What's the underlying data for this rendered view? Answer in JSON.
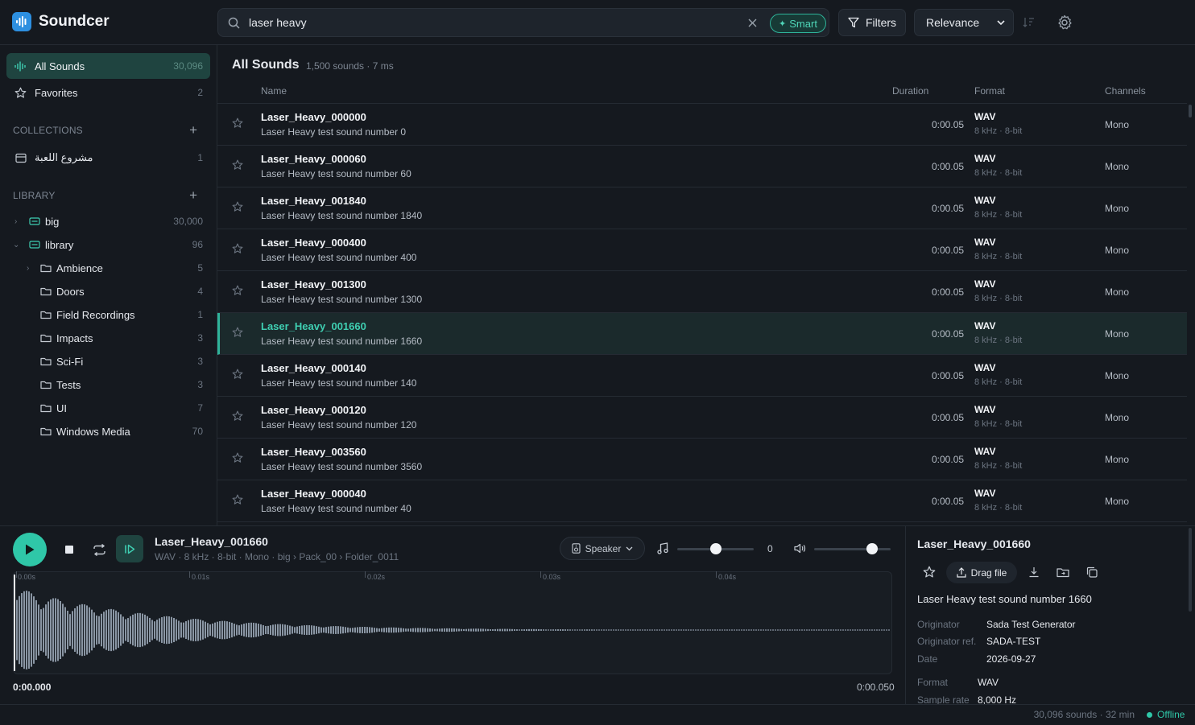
{
  "app": {
    "title": "Soundcer"
  },
  "search": {
    "value": "laser heavy",
    "smart_label": "Smart"
  },
  "toolbar": {
    "filters_label": "Filters",
    "sort_value": "Relevance"
  },
  "sidebar": {
    "all_sounds": {
      "label": "All Sounds",
      "count": "30,096"
    },
    "favorites": {
      "label": "Favorites",
      "count": "2"
    },
    "collections_header": "COLLECTIONS",
    "collections": [
      {
        "label": "مشروع اللعبة",
        "count": "1"
      }
    ],
    "library_header": "LIBRARY",
    "library": [
      {
        "label": "big",
        "count": "30,000"
      },
      {
        "label": "library",
        "count": "96"
      },
      {
        "label": "Ambience",
        "count": "5"
      },
      {
        "label": "Doors",
        "count": "4"
      },
      {
        "label": "Field Recordings",
        "count": "1"
      },
      {
        "label": "Impacts",
        "count": "3"
      },
      {
        "label": "Sci-Fi",
        "count": "3"
      },
      {
        "label": "Tests",
        "count": "3"
      },
      {
        "label": "UI",
        "count": "7"
      },
      {
        "label": "Windows Media",
        "count": "70"
      }
    ]
  },
  "main": {
    "title": "All Sounds",
    "subtitle": "1,500 sounds · 7 ms",
    "columns": {
      "name": "Name",
      "duration": "Duration",
      "format": "Format",
      "channels": "Channels"
    },
    "rows": [
      {
        "name": "Laser_Heavy_000000",
        "desc": "Laser Heavy test sound number 0",
        "duration": "0:00.05",
        "format": "WAV",
        "spec": "8 kHz · 8-bit",
        "channels": "Mono"
      },
      {
        "name": "Laser_Heavy_000060",
        "desc": "Laser Heavy test sound number 60",
        "duration": "0:00.05",
        "format": "WAV",
        "spec": "8 kHz · 8-bit",
        "channels": "Mono"
      },
      {
        "name": "Laser_Heavy_001840",
        "desc": "Laser Heavy test sound number 1840",
        "duration": "0:00.05",
        "format": "WAV",
        "spec": "8 kHz · 8-bit",
        "channels": "Mono"
      },
      {
        "name": "Laser_Heavy_000400",
        "desc": "Laser Heavy test sound number 400",
        "duration": "0:00.05",
        "format": "WAV",
        "spec": "8 kHz · 8-bit",
        "channels": "Mono"
      },
      {
        "name": "Laser_Heavy_001300",
        "desc": "Laser Heavy test sound number 1300",
        "duration": "0:00.05",
        "format": "WAV",
        "spec": "8 kHz · 8-bit",
        "channels": "Mono"
      },
      {
        "name": "Laser_Heavy_001660",
        "desc": "Laser Heavy test sound number 1660",
        "duration": "0:00.05",
        "format": "WAV",
        "spec": "8 kHz · 8-bit",
        "channels": "Mono",
        "selected": true
      },
      {
        "name": "Laser_Heavy_000140",
        "desc": "Laser Heavy test sound number 140",
        "duration": "0:00.05",
        "format": "WAV",
        "spec": "8 kHz · 8-bit",
        "channels": "Mono"
      },
      {
        "name": "Laser_Heavy_000120",
        "desc": "Laser Heavy test sound number 120",
        "duration": "0:00.05",
        "format": "WAV",
        "spec": "8 kHz · 8-bit",
        "channels": "Mono"
      },
      {
        "name": "Laser_Heavy_003560",
        "desc": "Laser Heavy test sound number 3560",
        "duration": "0:00.05",
        "format": "WAV",
        "spec": "8 kHz · 8-bit",
        "channels": "Mono"
      },
      {
        "name": "Laser_Heavy_000040",
        "desc": "Laser Heavy test sound number 40",
        "duration": "0:00.05",
        "format": "WAV",
        "spec": "8 kHz · 8-bit",
        "channels": "Mono"
      }
    ]
  },
  "player": {
    "title": "Laser_Heavy_001660",
    "meta": "WAV · 8 kHz · 8-bit · Mono · big › Pack_00 › Folder_0011",
    "speaker_label": "Speaker",
    "pitch_value": "0",
    "pitch_level": 0.5,
    "volume_level": 0.76,
    "ticks": [
      "0.00s",
      "0.01s",
      "0.02s",
      "0.03s",
      "0.04s"
    ],
    "time_start": "0:00.000",
    "time_end": "0:00.050"
  },
  "details": {
    "title": "Laser_Heavy_001660",
    "drag_label": "Drag file",
    "description": "Laser Heavy test sound number 1660",
    "fields": [
      {
        "key": "Originator",
        "value": "Sada Test Generator"
      },
      {
        "key": "Originator ref.",
        "value": "SADA-TEST"
      },
      {
        "key": "Date",
        "value": "2026-09-27"
      },
      {
        "key": "Format",
        "value": "WAV"
      },
      {
        "key": "Sample rate",
        "value": "8,000 Hz"
      }
    ]
  },
  "status": {
    "text": "30,096 sounds · 32 min",
    "online": "Offline"
  },
  "colors": {
    "accent": "#2fc7a8",
    "brand": "#2d8fe0",
    "background": "#15191f"
  }
}
